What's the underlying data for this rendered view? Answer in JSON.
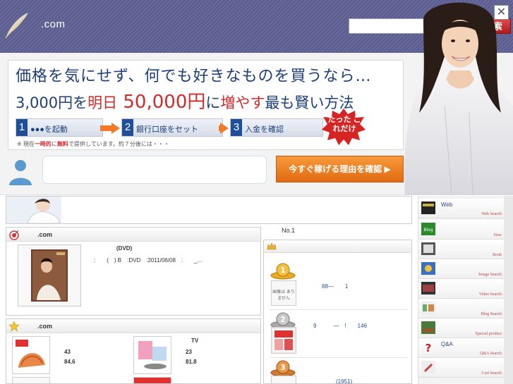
{
  "header": {
    "domain": ".com",
    "search_placeholder": "",
    "search_button": "検 索"
  },
  "ad": {
    "headline1": "価格を気にせず、何でも好きなものを買うなら…",
    "headline2_a": "3,000円を",
    "headline2_b": "明日",
    "headline2_c": " 50,000円",
    "headline2_d": "に",
    "headline2_e": "増やす",
    "headline2_f": "最も賢い方法",
    "steps": [
      {
        "num": "1",
        "label": "●●●を起動"
      },
      {
        "num": "2",
        "label": "銀行口座をセット"
      },
      {
        "num": "3",
        "label": "入金を確認"
      }
    ],
    "burst_text": "たった これだけ",
    "note_prefix": "※ 現在",
    "note_em1": "一時的",
    "note_mid1": "に",
    "note_em2": "無料",
    "note_suffix": "で提供しています。約７分後には・・・",
    "cta": "今すぐ稼げる理由を確認 ▶",
    "close": "✕"
  },
  "featured": {
    "title": ".com",
    "dvd_label": "(DVD)",
    "detail": ":　　(　) B　:DVD　:2011/06/08　:　　_..."
  },
  "ranking": {
    "header": "No.1",
    "items": [
      {
        "rank": "1",
        "thumb_text": "画像は ありません",
        "text": "88—　　1"
      },
      {
        "rank": "2",
        "text": "9　　　—　!　　146"
      },
      {
        "rank": "3",
        "text": "(1951)"
      }
    ]
  },
  "popular": {
    "title": ".com",
    "items": [
      {
        "a": "43",
        "b": "84.6"
      },
      {
        "head": "TV",
        "a": "23",
        "b": "81.8"
      }
    ]
  },
  "sidebar": {
    "items": [
      {
        "label": "Web",
        "sub": "Web Search"
      },
      {
        "label": "",
        "sub": "New"
      },
      {
        "label": "",
        "sub": "Book"
      },
      {
        "label": "",
        "sub": "Image Search"
      },
      {
        "label": "",
        "sub": "Video Search"
      },
      {
        "label": "",
        "sub": "Blog Search"
      },
      {
        "label": "",
        "sub": "Special product"
      },
      {
        "label": "Q&A",
        "sub": "Q&A Search"
      },
      {
        "label": "",
        "sub": "Cort Search"
      }
    ]
  }
}
